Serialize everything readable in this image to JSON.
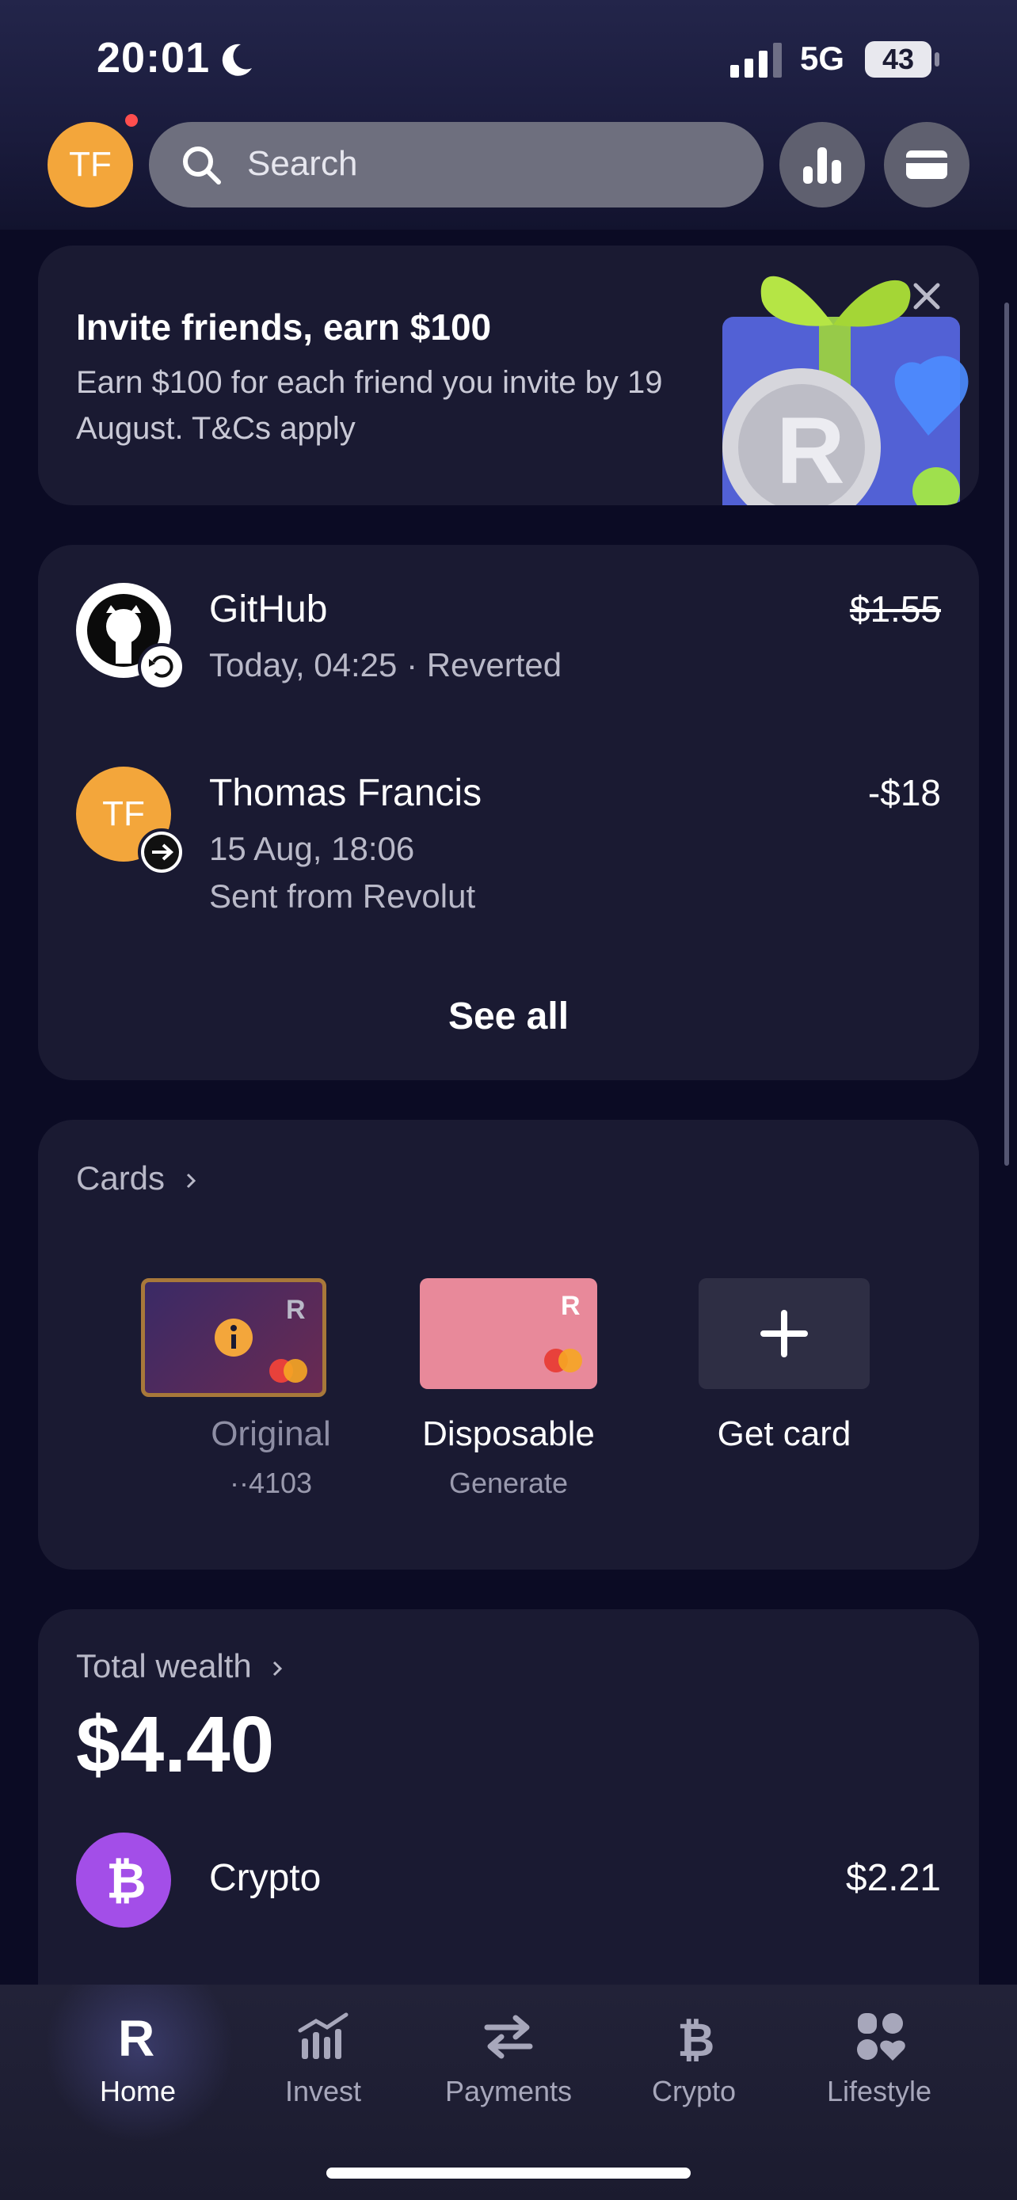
{
  "status_bar": {
    "time": "20:01",
    "network": "5G",
    "battery": "43"
  },
  "header": {
    "avatar_initials": "TF",
    "search_placeholder": "Search"
  },
  "promo": {
    "title": "Invite friends, earn $100",
    "description": "Earn $100 for each friend you invite by 19 August. T&Cs apply"
  },
  "transactions": [
    {
      "name": "GitHub",
      "subtitle": "Today, 04:25 · Reverted",
      "amount": "$1.55",
      "reverted": true
    },
    {
      "name": "Thomas Francis",
      "initials": "TF",
      "subtitle_line1": "15 Aug, 18:06",
      "subtitle_line2": "Sent from Revolut",
      "amount": "-$18"
    }
  ],
  "see_all_label": "See all",
  "cards_section": {
    "title": "Cards",
    "items": [
      {
        "label": "Original",
        "sub": "··4103"
      },
      {
        "label": "Disposable",
        "sub": "Generate"
      },
      {
        "label": "Get card",
        "sub": ""
      }
    ]
  },
  "wealth": {
    "title": "Total wealth",
    "amount": "$4.40",
    "crypto_label": "Crypto",
    "crypto_value": "$2.21"
  },
  "nav": [
    {
      "label": "Home",
      "icon": "revolut-r-icon",
      "active": true
    },
    {
      "label": "Invest",
      "icon": "invest-chart-icon"
    },
    {
      "label": "Payments",
      "icon": "transfer-arrows-icon"
    },
    {
      "label": "Crypto",
      "icon": "bitcoin-icon"
    },
    {
      "label": "Lifestyle",
      "icon": "lifestyle-icon"
    }
  ],
  "colors": {
    "background": "#0b0b24",
    "card": "#1a1a32",
    "avatar": "#f3a63b",
    "crypto": "#a34ee8",
    "disposable_card": "#e8899a"
  }
}
